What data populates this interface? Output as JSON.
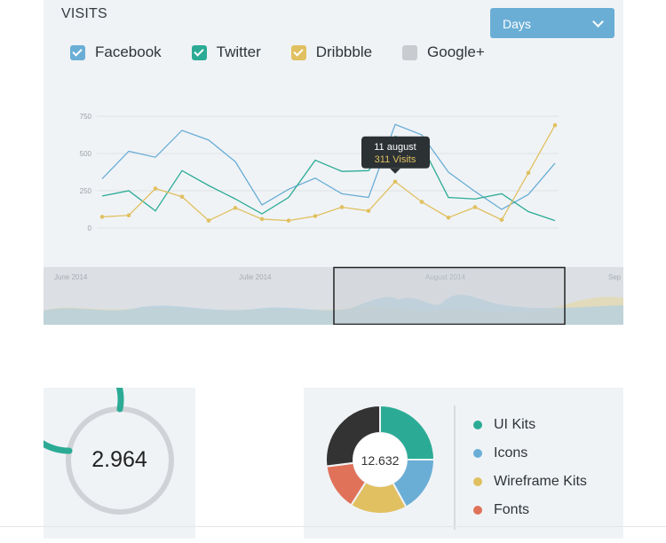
{
  "header": {
    "title": "VISITS",
    "range_select": "Days"
  },
  "colors": {
    "facebook": "#6aaed6",
    "twitter": "#2bab95",
    "dribbble": "#e0c060",
    "googleplus": "#c8ccd0",
    "dark": "#333333",
    "fonts": "#e0725a"
  },
  "legend": [
    {
      "label": "Facebook",
      "checked": true,
      "color": "#6aaed6"
    },
    {
      "label": "Twitter",
      "checked": true,
      "color": "#2bab95"
    },
    {
      "label": "Dribbble",
      "checked": true,
      "color": "#e0c060"
    },
    {
      "label": "Google+",
      "checked": false,
      "color": "#c8ccd0"
    }
  ],
  "chart_data": {
    "type": "line",
    "y_ticks": [
      "750",
      "500",
      "250",
      "0"
    ],
    "ylim": [
      0,
      750
    ],
    "series": [
      {
        "name": "Facebook",
        "values": [
          330,
          515,
          475,
          655,
          590,
          445,
          155,
          260,
          335,
          230,
          205,
          695,
          625,
          375,
          245,
          125,
          225,
          435
        ]
      },
      {
        "name": "Twitter",
        "values": [
          215,
          250,
          115,
          385,
          285,
          195,
          95,
          205,
          455,
          380,
          385,
          615,
          555,
          205,
          195,
          230,
          110,
          50
        ]
      },
      {
        "name": "Dribbble",
        "values": [
          75,
          85,
          265,
          210,
          50,
          135,
          60,
          50,
          80,
          140,
          115,
          311,
          175,
          70,
          140,
          55,
          370,
          690
        ]
      }
    ],
    "tooltip": {
      "date": "11 august",
      "value": "311 Visits",
      "point_index": 11
    }
  },
  "navigator": {
    "labels": [
      "June 2014",
      "Julie 2014",
      "August 2014",
      "Sep"
    ]
  },
  "gauge": {
    "value": "2.964",
    "fraction": 0.78
  },
  "donut": {
    "center": "12.632",
    "slices": [
      {
        "label": "UI Kits",
        "value": 25,
        "color": "#2bab95"
      },
      {
        "label": "Icons",
        "value": 17,
        "color": "#6aaed6"
      },
      {
        "label": "Wireframe Kits",
        "value": 17,
        "color": "#e0c060"
      },
      {
        "label": "Fonts",
        "value": 14,
        "color": "#e0725a"
      },
      {
        "label": "",
        "value": 27,
        "color": "#333333"
      }
    ]
  }
}
